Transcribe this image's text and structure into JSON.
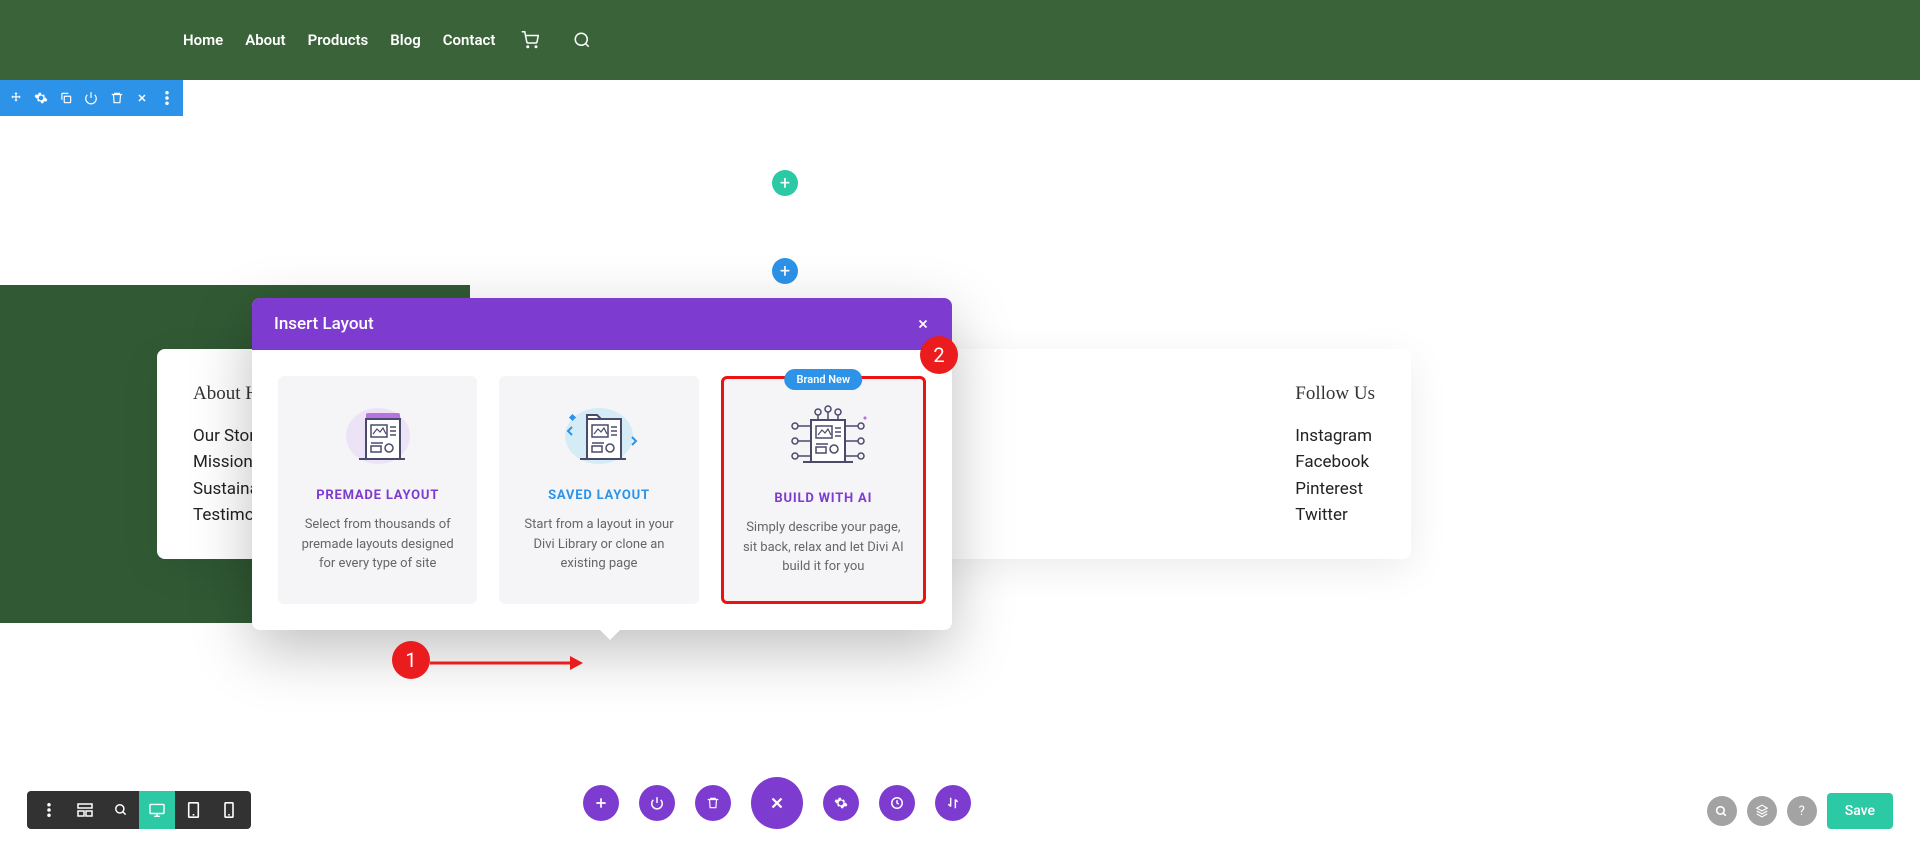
{
  "nav": {
    "items": [
      "Home",
      "About",
      "Products",
      "Blog",
      "Contact"
    ]
  },
  "modal": {
    "title": "Insert Layout",
    "cards": [
      {
        "title": "PREMADE LAYOUT",
        "title_color": "#7e3bd0",
        "desc": "Select from thousands of premade layouts designed for every type of site"
      },
      {
        "title": "SAVED LAYOUT",
        "title_color": "#2c93e8",
        "desc": "Start from a layout in your Divi Library or clone an existing page"
      },
      {
        "title": "BUILD WITH AI",
        "title_color": "#7e3bd0",
        "desc": "Simply describe your page, sit back, relax and let Divi AI build it for you",
        "badge": "Brand New"
      }
    ]
  },
  "footer": {
    "col1": {
      "title": "About H",
      "links": [
        "Our Stor",
        "Mission",
        "Sustaina",
        "Testimo"
      ]
    },
    "col2": {
      "title": "Follow Us",
      "links": [
        "Instagram",
        "Facebook",
        "Pinterest",
        "Twitter"
      ]
    }
  },
  "callouts": {
    "one": "1",
    "two": "2"
  },
  "bottom": {
    "save": "Save"
  }
}
